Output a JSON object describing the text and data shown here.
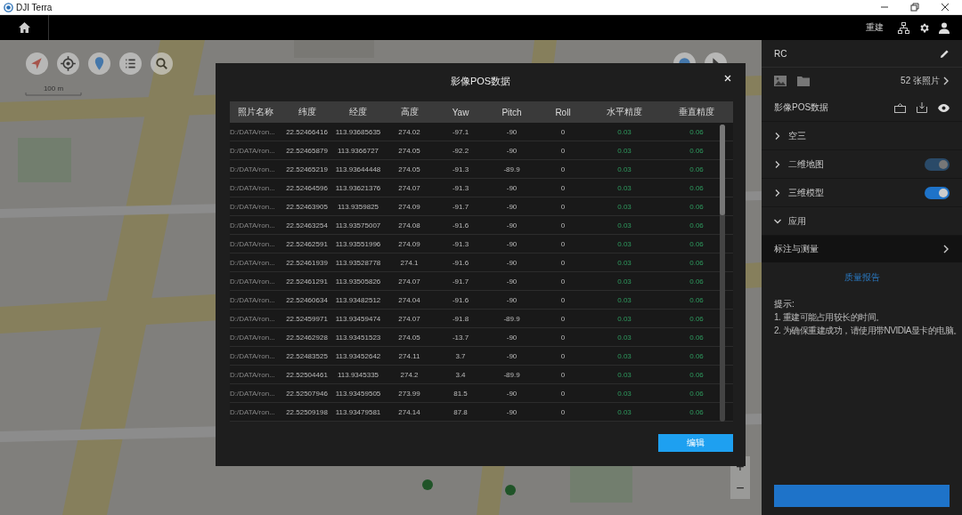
{
  "window": {
    "title": "DJI Terra"
  },
  "topbar": {
    "rebuild": "重建"
  },
  "map": {
    "scale": "100 m",
    "zoom": [
      "+",
      "−"
    ]
  },
  "dialog": {
    "title": "影像POS数据",
    "columns": [
      "照片名称",
      "纬度",
      "经度",
      "高度",
      "Yaw",
      "Pitch",
      "Roll",
      "水平精度",
      "垂直精度"
    ],
    "rows": [
      [
        "D:/DATA/ron...",
        "22.52466416",
        "113.93685635",
        "274.02",
        "-97.1",
        "-90",
        "0",
        "0.03",
        "0.06"
      ],
      [
        "D:/DATA/ron...",
        "22.52465879",
        "113.9366727",
        "274.05",
        "-92.2",
        "-90",
        "0",
        "0.03",
        "0.06"
      ],
      [
        "D:/DATA/ron...",
        "22.52465219",
        "113.93644448",
        "274.05",
        "-91.3",
        "-89.9",
        "0",
        "0.03",
        "0.06"
      ],
      [
        "D:/DATA/ron...",
        "22.52464596",
        "113.93621376",
        "274.07",
        "-91.3",
        "-90",
        "0",
        "0.03",
        "0.06"
      ],
      [
        "D:/DATA/ron...",
        "22.52463905",
        "113.9359825",
        "274.09",
        "-91.7",
        "-90",
        "0",
        "0.03",
        "0.06"
      ],
      [
        "D:/DATA/ron...",
        "22.52463254",
        "113.93575007",
        "274.08",
        "-91.6",
        "-90",
        "0",
        "0.03",
        "0.06"
      ],
      [
        "D:/DATA/ron...",
        "22.52462591",
        "113.93551996",
        "274.09",
        "-91.3",
        "-90",
        "0",
        "0.03",
        "0.06"
      ],
      [
        "D:/DATA/ron...",
        "22.52461939",
        "113.93528778",
        "274.1",
        "-91.6",
        "-90",
        "0",
        "0.03",
        "0.06"
      ],
      [
        "D:/DATA/ron...",
        "22.52461291",
        "113.93505826",
        "274.07",
        "-91.7",
        "-90",
        "0",
        "0.03",
        "0.06"
      ],
      [
        "D:/DATA/ron...",
        "22.52460634",
        "113.93482512",
        "274.04",
        "-91.6",
        "-90",
        "0",
        "0.03",
        "0.06"
      ],
      [
        "D:/DATA/ron...",
        "22.52459971",
        "113.93459474",
        "274.07",
        "-91.8",
        "-89.9",
        "0",
        "0.03",
        "0.06"
      ],
      [
        "D:/DATA/ron...",
        "22.52462928",
        "113.93451523",
        "274.05",
        "-13.7",
        "-90",
        "0",
        "0.03",
        "0.06"
      ],
      [
        "D:/DATA/ron...",
        "22.52483525",
        "113.93452642",
        "274.11",
        "3.7",
        "-90",
        "0",
        "0.03",
        "0.06"
      ],
      [
        "D:/DATA/ron...",
        "22.52504461",
        "113.9345335",
        "274.2",
        "3.4",
        "-89.9",
        "0",
        "0.03",
        "0.06"
      ],
      [
        "D:/DATA/ron...",
        "22.52507946",
        "113.93459505",
        "273.99",
        "81.5",
        "-90",
        "0",
        "0.03",
        "0.06"
      ],
      [
        "D:/DATA/ron...",
        "22.52509198",
        "113.93479581",
        "274.14",
        "87.8",
        "-90",
        "0",
        "0.03",
        "0.06"
      ]
    ],
    "edit_button": "编辑"
  },
  "sidebar": {
    "project": "RC",
    "photo_count": "52 张照片",
    "pos_label": "影像POS数据",
    "sections": [
      {
        "label": "空三",
        "kind": "plain",
        "expanded": false
      },
      {
        "label": "二维地图",
        "kind": "toggle",
        "expanded": false,
        "on": true,
        "disabled": true
      },
      {
        "label": "三维模型",
        "kind": "toggle",
        "expanded": false,
        "on": true,
        "disabled": false
      },
      {
        "label": "应用",
        "kind": "plain",
        "expanded": true
      }
    ],
    "tool": "标注与测量",
    "report_link": "质量报告",
    "hint_title": "提示:",
    "hints": [
      "1. 重建可能占用较长的时间。",
      "2. 为确保重建成功，请使用带NVIDIA显卡的电脑。"
    ]
  }
}
